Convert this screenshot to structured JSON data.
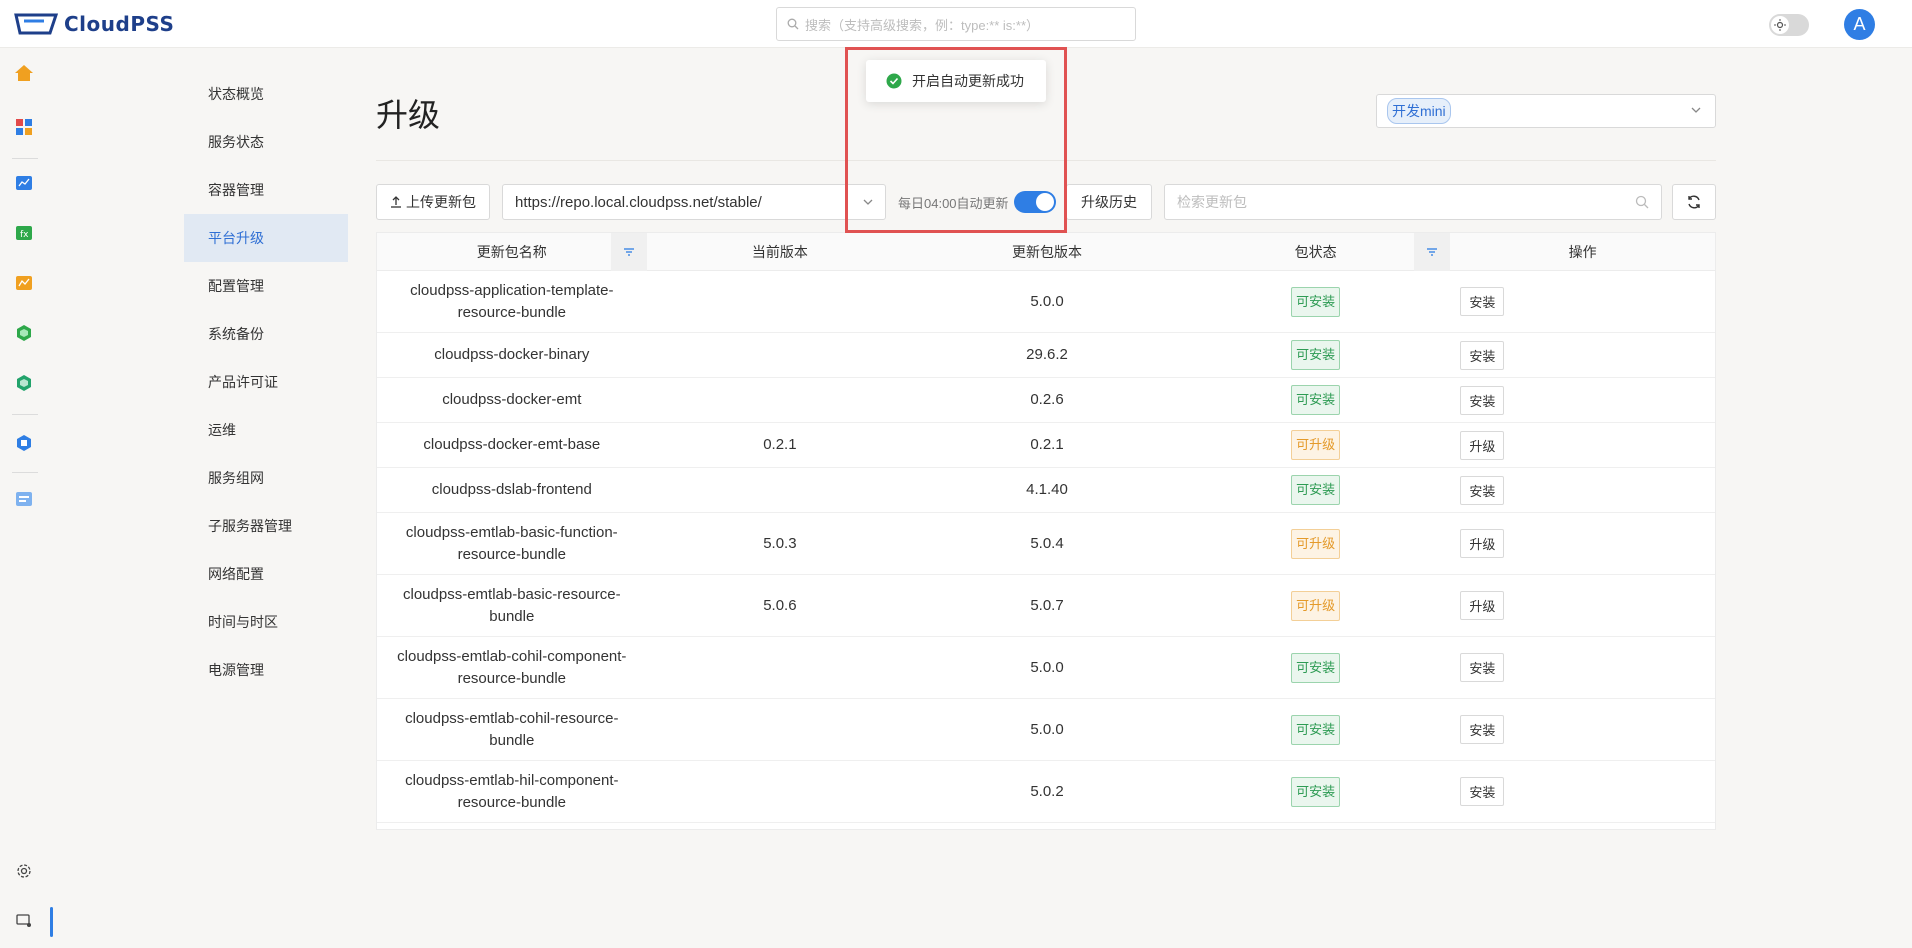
{
  "app": {
    "logo_text": "CloudPSS"
  },
  "header": {
    "search_placeholder": "搜索（支持高级搜索，例：type:** is:**）",
    "avatar_letter": "A"
  },
  "rail": {
    "icons": [
      "home-icon",
      "apps-icon",
      "chart-app-icon",
      "function-app-icon",
      "analytics-app-icon",
      "hexagon-app-green-icon",
      "hexagon-app-teal-icon",
      "model-app-icon",
      "document-app-icon"
    ],
    "bottom": [
      "settings-icon",
      "admin-panel-icon"
    ]
  },
  "subnav": {
    "items": [
      "状态概览",
      "服务状态",
      "容器管理",
      "平台升级",
      "配置管理",
      "系统备份",
      "产品许可证",
      "运维",
      "服务组网",
      "子服务器管理",
      "网络配置",
      "时间与时区",
      "电源管理"
    ],
    "active_index": 3
  },
  "main": {
    "title": "升级",
    "env_tag": "开发mini",
    "upload_label": "上传更新包",
    "repo_url": "https://repo.local.cloudpss.net/stable/",
    "auto_update_label": "每日04:00自动更新",
    "auto_update_on": true,
    "history_label": "升级历史",
    "pkg_search_placeholder": "检索更新包"
  },
  "toast": {
    "message": "开启自动更新成功"
  },
  "table": {
    "columns": [
      "更新包名称",
      "当前版本",
      "更新包版本",
      "包状态",
      "操作"
    ],
    "rows": [
      {
        "name": "cloudpss-application-template-resource-bundle",
        "current": "",
        "latest": "5.0.0",
        "status": "可安装",
        "action": "安装"
      },
      {
        "name": "cloudpss-docker-binary",
        "current": "",
        "latest": "29.6.2",
        "status": "可安装",
        "action": "安装"
      },
      {
        "name": "cloudpss-docker-emt",
        "current": "",
        "latest": "0.2.6",
        "status": "可安装",
        "action": "安装"
      },
      {
        "name": "cloudpss-docker-emt-base",
        "current": "0.2.1",
        "latest": "0.2.1",
        "status": "可升级",
        "action": "升级"
      },
      {
        "name": "cloudpss-dslab-frontend",
        "current": "",
        "latest": "4.1.40",
        "status": "可安装",
        "action": "安装"
      },
      {
        "name": "cloudpss-emtlab-basic-function-resource-bundle",
        "current": "5.0.3",
        "latest": "5.0.4",
        "status": "可升级",
        "action": "升级"
      },
      {
        "name": "cloudpss-emtlab-basic-resource-bundle",
        "current": "5.0.6",
        "latest": "5.0.7",
        "status": "可升级",
        "action": "升级"
      },
      {
        "name": "cloudpss-emtlab-cohil-component-resource-bundle",
        "current": "",
        "latest": "5.0.0",
        "status": "可安装",
        "action": "安装"
      },
      {
        "name": "cloudpss-emtlab-cohil-resource-bundle",
        "current": "",
        "latest": "5.0.0",
        "status": "可安装",
        "action": "安装"
      },
      {
        "name": "cloudpss-emtlab-hil-component-resource-bundle",
        "current": "",
        "latest": "5.0.2",
        "status": "可安装",
        "action": "安装"
      }
    ]
  },
  "colors": {
    "accent": "#2f7ee4",
    "installable": "#2e9b54",
    "upgradable": "#e49a2a",
    "highlight": "#e05252"
  }
}
